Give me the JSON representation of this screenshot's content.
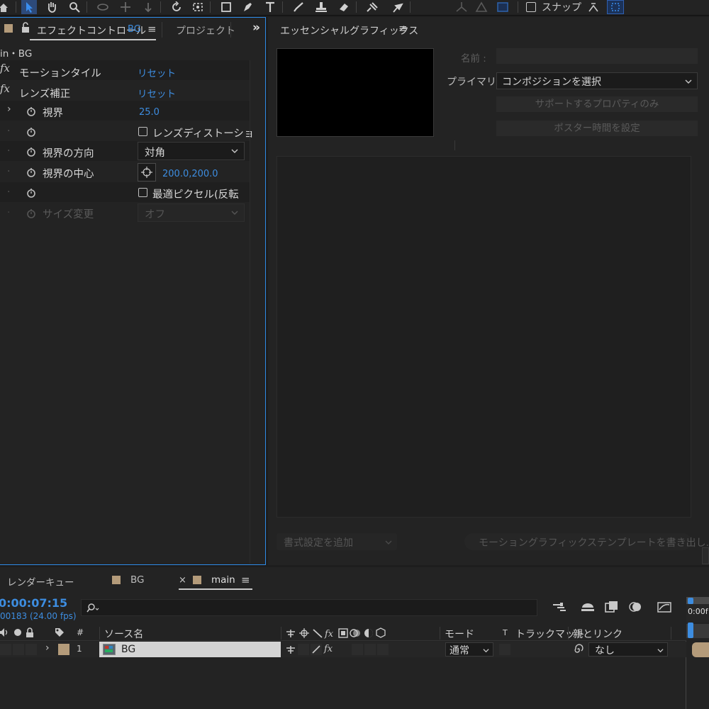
{
  "colors": {
    "accent": "#2e8be8",
    "link_blue": "#3d8de0",
    "label_tan": "#b49b7a",
    "panel_bg": "#232323",
    "dark_bg": "#1d1d1d"
  },
  "toolbar": {
    "snap_label": "スナップ",
    "icons": [
      "home-icon",
      "selection-tool-icon",
      "hand-tool-icon",
      "zoom-tool-icon",
      "orbit-camera-icon",
      "pan-camera-icon",
      "dolly-camera-icon",
      "rotate-tool-icon",
      "pan-behind-icon",
      "rectangle-tool-icon",
      "pen-tool-icon",
      "type-tool-icon",
      "brush-tool-icon",
      "clone-stamp-icon",
      "eraser-tool-icon",
      "roto-brush-icon",
      "puppet-pin-icon",
      "axis-local-icon",
      "axis-world-icon",
      "axis-view-icon",
      "snap-icon",
      "align-icon"
    ]
  },
  "effect_controls": {
    "tab_label": "エフェクトコントロール",
    "tab_layer": "BG",
    "project_tab": "プロジェクト",
    "breadcrumb": "in・BG",
    "fx_badge": "fx",
    "effects": [
      {
        "name": "モーションタイル",
        "reset": "リセット"
      },
      {
        "name": "レンズ補正",
        "reset": "リセット"
      }
    ],
    "props": {
      "fov_label": "視界",
      "fov_value": "25.0",
      "lens_distortion_label": "レンズディストーショ",
      "fov_orientation_label": "視界の方向",
      "fov_orientation_value": "対角",
      "fov_center_label": "視界の中心",
      "fov_center_value": "200.0,200.0",
      "optimal_pixels_label": "最適ピクセル(反転",
      "resize_label": "サイズ変更",
      "resize_value": "オフ"
    }
  },
  "essential_graphics": {
    "title": "エッセンシャルグラフィックス",
    "name_label": "名前 :",
    "primary_label": "プライマリ:",
    "primary_value": "コンポジションを選択",
    "solo_props_button": "サポートするプロパティのみ",
    "poster_time_button": "ポスター時間を設定",
    "add_format_label": "書式設定を追加",
    "export_template_button": "モーショングラフィックステンプレートを書き出し..."
  },
  "timeline": {
    "render_queue_tab": "レンダーキュー",
    "bg_tab": "BG",
    "close_glyph": "×",
    "main_tab": "main",
    "timecode": "0:00:07:15",
    "frame_info": "00183 (24.00 fps)",
    "search_placeholder": "",
    "ruler_label": "0:00f",
    "columns": {
      "number": "#",
      "source_name": "ソース名",
      "mode": "モード",
      "t": "T",
      "track_matte": "トラックマット",
      "parent": "親とリンク"
    },
    "layer": {
      "number": "1",
      "name": "BG",
      "mode": "通常",
      "parent": "なし"
    }
  }
}
